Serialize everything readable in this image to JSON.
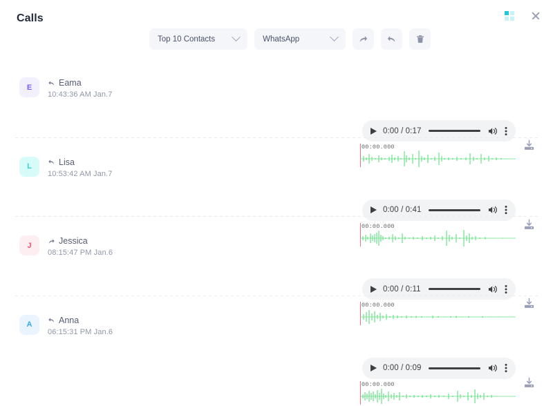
{
  "header": {
    "title": "Calls",
    "grid_icon": "grid-icon",
    "close_icon": "close-icon"
  },
  "toolbar": {
    "contacts_filter": "Top 10 Contacts",
    "source_filter": "WhatsApp",
    "forward_label": "forward-icon",
    "reply_label": "reply-icon",
    "delete_label": "trash-icon"
  },
  "player_common": {
    "current_time": "0:00",
    "wave_timestamp": "00:00.000",
    "play_icon": "play-icon",
    "volume_icon": "volume-icon",
    "menu_icon": "kebab-menu-icon",
    "download_icon": "download-icon"
  },
  "colors": {
    "accent_teal": "#1ec8d4",
    "waveform_green": "#57e07a",
    "playhead_red": "#f4717a",
    "player_bg": "#f1f3f4",
    "pill_bg": "#f4f6fa"
  },
  "calls": [
    {
      "initial": "E",
      "name": "Eama",
      "time": "10:43:36 AM Jan.7",
      "direction": "incoming",
      "duration": "0:17",
      "time_display": "0:00 / 0:17",
      "avatar_bg": "#f3f0fe",
      "avatar_fg": "#7c5cf5"
    },
    {
      "initial": "L",
      "name": "Lisa",
      "time": "10:53:42 AM Jan.7",
      "direction": "incoming",
      "duration": "0:41",
      "time_display": "0:00 / 0:41",
      "avatar_bg": "#d6fbf8",
      "avatar_fg": "#34d3c8"
    },
    {
      "initial": "J",
      "name": "Jessica",
      "time": "08:15:47 PM Jan.6",
      "direction": "outgoing",
      "duration": "0:11",
      "time_display": "0:00 / 0:11",
      "avatar_bg": "#fdeef1",
      "avatar_fg": "#f2547a"
    },
    {
      "initial": "A",
      "name": "Anna",
      "time": "06:15:31 PM Jan.6",
      "direction": "incoming",
      "duration": "0:09",
      "time_display": "0:00 / 0:09",
      "avatar_bg": "#eaf4fe",
      "avatar_fg": "#36a8f5"
    }
  ]
}
